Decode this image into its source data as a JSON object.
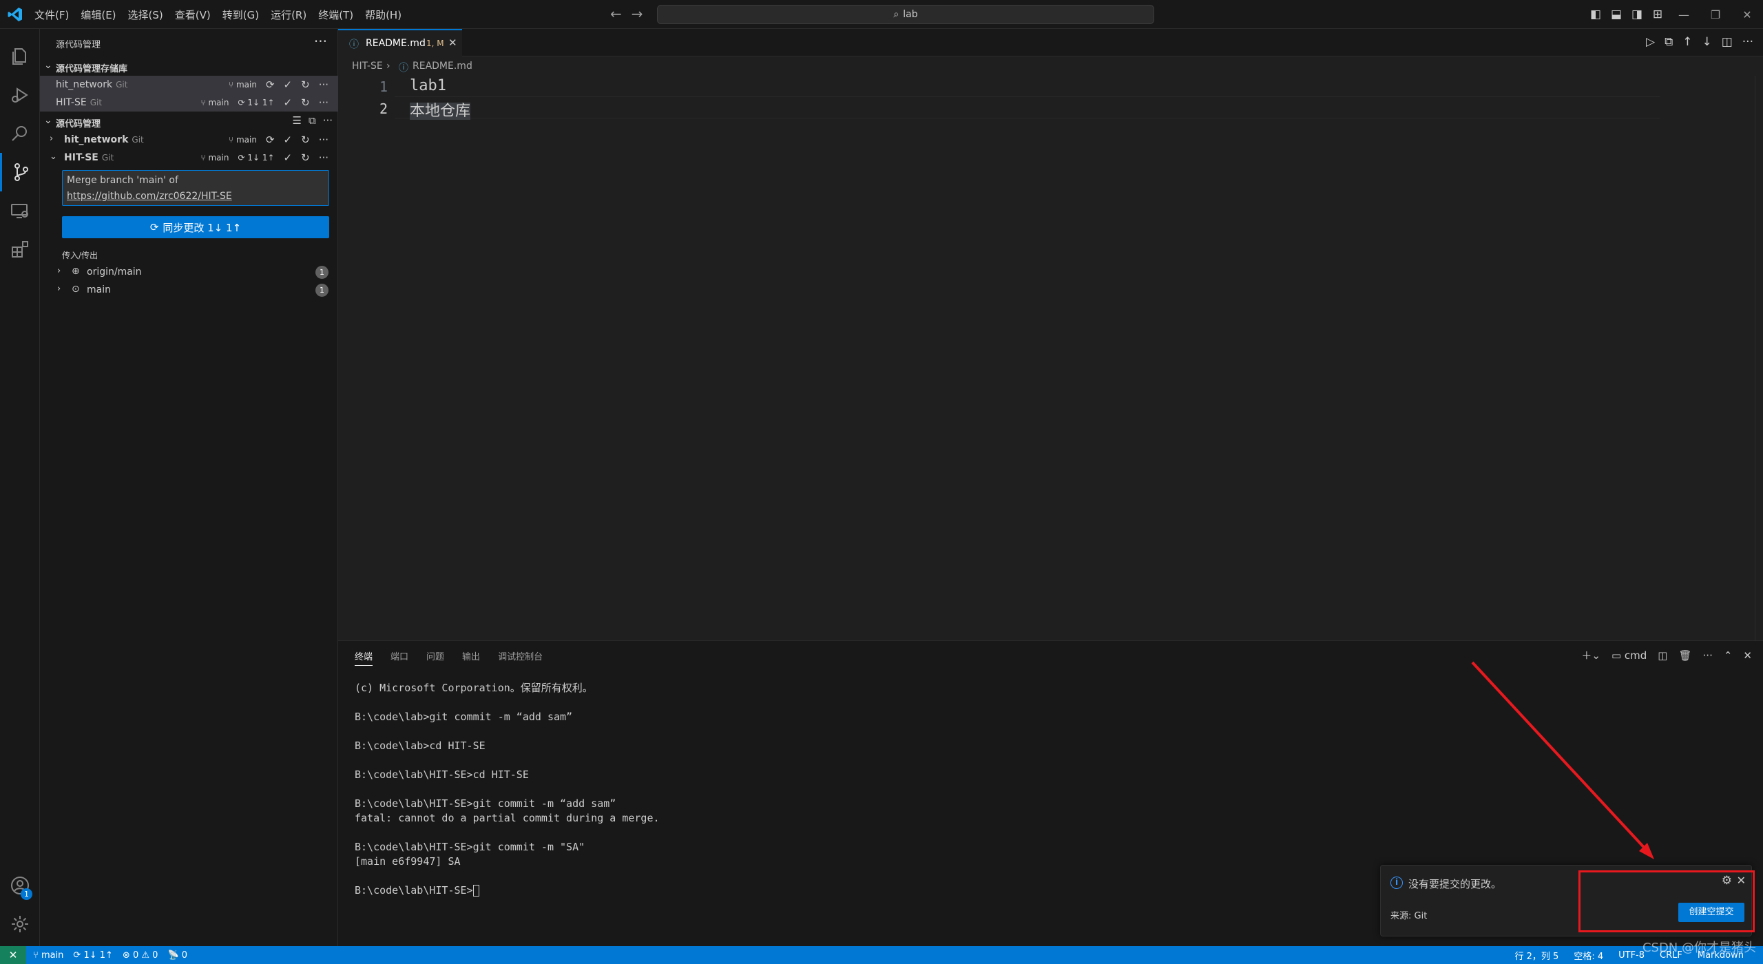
{
  "titlebar": {
    "menus": [
      "文件(F)",
      "编辑(E)",
      "选择(S)",
      "查看(V)",
      "转到(G)",
      "运行(R)",
      "终端(T)",
      "帮助(H)"
    ],
    "search": "lab"
  },
  "activity": {
    "accounts_badge": "1"
  },
  "sidebar": {
    "title": "源代码管理",
    "repos_section": "源代码管理存储库",
    "repos": [
      {
        "name": "hit_network",
        "kind": "Git",
        "branch": "main",
        "sync": ""
      },
      {
        "name": "HIT-SE",
        "kind": "Git",
        "branch": "main",
        "sync": "1↓ 1↑"
      }
    ],
    "scm_section": "源代码管理",
    "scm_repos": [
      {
        "name": "hit_network",
        "kind": "Git",
        "branch": "main",
        "sync": ""
      },
      {
        "name": "HIT-SE",
        "kind": "Git",
        "branch": "main",
        "sync": "1↓ 1↑"
      }
    ],
    "commit_message": {
      "line1": "Merge branch 'main' of",
      "line2": "https://github.com/zrc0622/HIT-SE"
    },
    "sync_button": "同步更改 1↓ 1↑",
    "incoming_outgoing": "传入/传出",
    "refs": [
      {
        "name": "origin/main",
        "count": "1"
      },
      {
        "name": "main",
        "count": "1"
      }
    ]
  },
  "editor": {
    "tab": {
      "name": "README.md",
      "status": "1, M"
    },
    "breadcrumb": {
      "folder": "HIT-SE",
      "file": "README.md"
    },
    "lines": [
      {
        "number": "1",
        "text": "lab1"
      },
      {
        "number": "2",
        "text": "本地仓库"
      }
    ]
  },
  "panel": {
    "tabs": [
      "终端",
      "端口",
      "问题",
      "输出",
      "调试控制台"
    ],
    "shell": "cmd",
    "terminal": [
      "(c) Microsoft Corporation。保留所有权利。",
      "",
      "B:\\code\\lab>git commit -m “add sam”",
      "",
      "B:\\code\\lab>cd HIT-SE",
      "",
      "B:\\code\\lab\\HIT-SE>cd HIT-SE",
      "",
      "B:\\code\\lab\\HIT-SE>git commit -m “add sam”",
      "fatal: cannot do a partial commit during a merge.",
      "",
      "B:\\code\\lab\\HIT-SE>git commit -m \"SA\"",
      "[main e6f9947] SA",
      "",
      "B:\\code\\lab\\HIT-SE>"
    ]
  },
  "notification": {
    "message": "没有要提交的更改。",
    "source": "来源: Git",
    "button": "创建空提交"
  },
  "statusbar": {
    "branch": "main",
    "sync": "1↓ 1↑",
    "problems": "0",
    "warnings": "0",
    "ports": "0",
    "position": "行 2，列 5",
    "spaces": "空格: 4",
    "encoding": "UTF-8",
    "eol": "CRLF",
    "language": "Markdown"
  },
  "watermark": "CSDN @你才是猪头",
  "colors": {
    "accent": "#0078d4",
    "remote": "#16825d",
    "annotation": "#e8191e",
    "modified": "#e2c08d"
  }
}
